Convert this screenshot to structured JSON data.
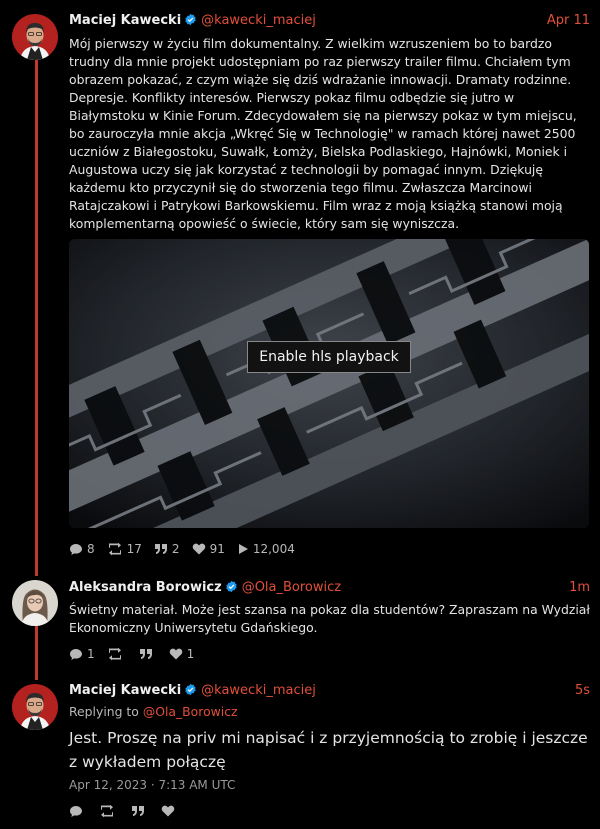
{
  "post1": {
    "author_name": "Maciej Kawecki",
    "author_handle": "@kawecki_maciej",
    "time": "Apr 11",
    "text": "Mój pierwszy w życiu film dokumentalny. Z wielkim wzruszeniem bo to bardzo trudny dla mnie projekt udostępniam po raz pierwszy trailer filmu. Chciałem tym obrazem pokazać, z czym wiąże się dziś wdrażanie innowacji. Dramaty rodzinne. Depresje. Konflikty interesów. Pierwszy pokaz filmu odbędzie się jutro w Białymstoku w Kinie Forum. Zdecydowałem się na pierwszy pokaz w tym miejscu, bo zauroczyła mnie akcja „Wkręć Się w Technologię\" w ramach której nawet 2500 uczniów z Białegostoku, Suwałk, Łomży, Bielska Podlaskiego, Hajnówki, Moniek i Augustowa uczy się jak korzystać z technologii by pomagać innym. Dziękuję każdemu kto przyczynił się do stworzenia tego filmu. Zwłaszcza Marcinowi Ratajczakowi i Patrykowi Barkowskiemu. Film wraz z moją książką stanowi moją komplementarną opowieść o świecie, który sam się wyniszcza.",
    "media_button": "Enable hls playback",
    "stats": {
      "replies": "8",
      "reposts": "17",
      "quotes": "2",
      "likes": "91",
      "views": "12,004"
    }
  },
  "post2": {
    "author_name": "Aleksandra Borowicz",
    "author_handle": "@Ola_Borowicz",
    "time": "1m",
    "text": "Świetny materiał. Może jest szansa na pokaz dla studentów? Zapraszam na Wydział Ekonomiczny Uniwersytetu Gdańskiego.",
    "stats": {
      "replies": "1",
      "likes": "1"
    }
  },
  "post3": {
    "author_name": "Maciej Kawecki",
    "author_handle": "@kawecki_maciej",
    "time": "5s",
    "replying_prefix": "Replying to",
    "replying_handle": "@Ola_Borowicz",
    "text": "Jest. Proszę na priv mi napisać i z przyjemnością to zrobię i jeszcze z wykładem połączę",
    "date": "Apr 12, 2023 · 7:13 AM UTC"
  },
  "colors": {
    "accent": "#e0503a",
    "thread_line": "#c0392b",
    "verified": "#1d9bf0",
    "background": "#000000"
  },
  "icons": [
    "reply-icon",
    "repost-icon",
    "quote-icon",
    "like-icon",
    "views-icon",
    "verified-icon"
  ]
}
